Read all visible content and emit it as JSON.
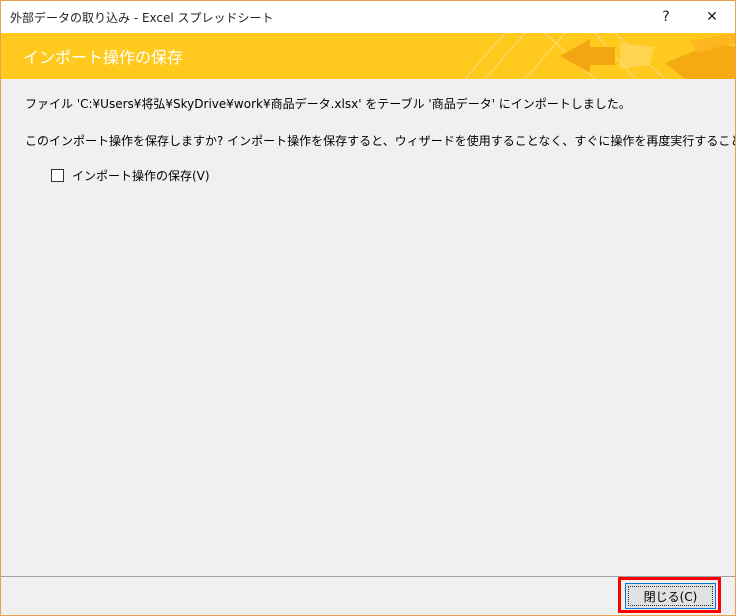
{
  "window": {
    "title": "外部データの取り込み - Excel スプレッドシート",
    "help_label": "?",
    "close_label": "✕"
  },
  "banner": {
    "title": "インポート操作の保存"
  },
  "content": {
    "message_import": "ファイル 'C:¥Users¥将弘¥SkyDrive¥work¥商品データ.xlsx' をテーブル '商品データ' にインポートしました。",
    "message_question": "このインポート操作を保存しますか? インポート操作を保存すると、ウィザードを使用することなく、すぐに操作を再度実行することができます。",
    "save_checkbox_label": "インポート操作の保存(V)",
    "save_checkbox_checked": false
  },
  "footer": {
    "close_button_label": "閉じる(C)"
  },
  "colors": {
    "banner": "#ffc91e",
    "window_border": "#e9a24a",
    "highlight": "#ff0000",
    "button_border": "#0078d7"
  }
}
